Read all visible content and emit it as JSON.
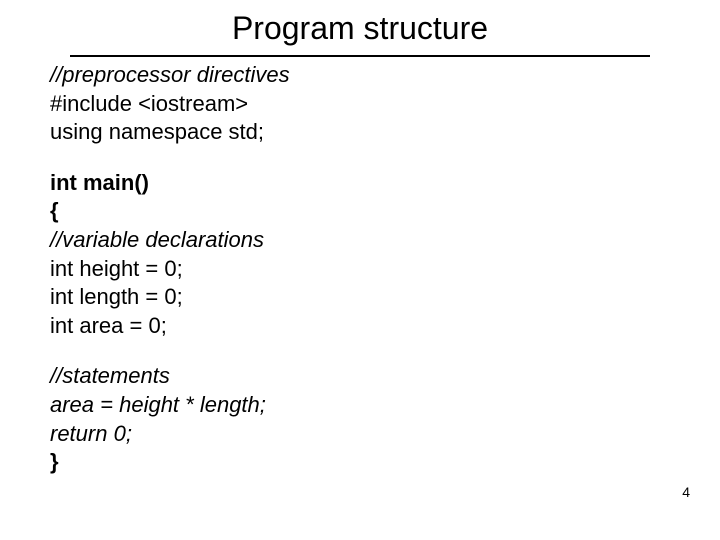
{
  "title": "Program structure",
  "preprocessor_comment": "//preprocessor directives",
  "include_line": "#include <iostream>",
  "namespace_line": "using namespace std;",
  "main_decl": "int main()",
  "open_brace": "{",
  "var_comment": "//variable declarations",
  "var_height": "int height = 0;",
  "var_length": "int length = 0;",
  "var_area": "int area = 0;",
  "stmt_comment": "//statements",
  "stmt_area": "area = height * length;",
  "stmt_return": "return 0;",
  "close_brace": "}",
  "page_number": "4"
}
